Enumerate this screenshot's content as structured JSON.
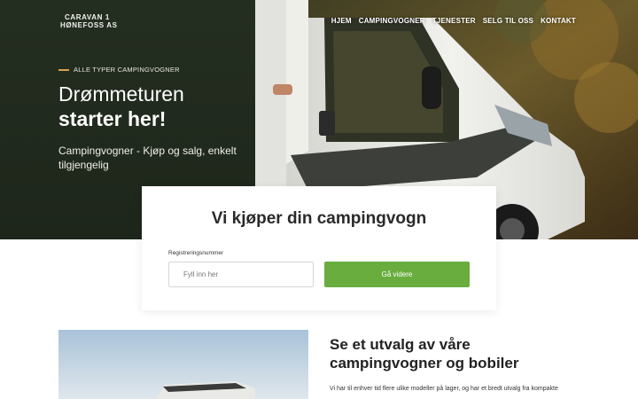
{
  "brand": {
    "line1": "CARAVAN 1",
    "line2": "HØNEFOSS AS"
  },
  "nav": {
    "items": [
      "HJEM",
      "CAMPINGVOGNER",
      "TJENESTER",
      "SELG TIL OSS",
      "KONTAKT"
    ]
  },
  "hero": {
    "eyebrow": "ALLE TYPER CAMPINGVOGNER",
    "title_line1": "Drømmeturen",
    "title_line2": "starter her!",
    "subtitle": "Campingvogner - Kjøp og salg, enkelt tilgjengelig"
  },
  "buy_card": {
    "title": "Vi kjøper din campingvogn",
    "field_label": "Registreringsnummer",
    "placeholder": "Fyll inn her",
    "button": "Gå videre"
  },
  "selection": {
    "title": "Se et utvalg av våre campingvogner og bobiler",
    "body": "Vi har til enhver tid flere ulike modeller på lager, og har et bredt utvalg fra kompakte"
  },
  "colors": {
    "accent_green": "#69ad3e",
    "hero_dark": "#212b1f",
    "eyebrow_dash": "#d8a24a"
  }
}
